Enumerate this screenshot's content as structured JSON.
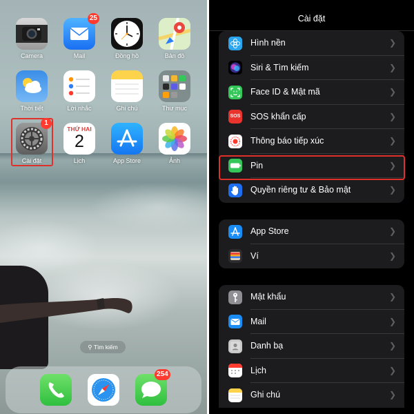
{
  "home_screen": {
    "apps": [
      {
        "label": "Camera",
        "icon": "camera-icon"
      },
      {
        "label": "Mail",
        "icon": "mail-icon",
        "badge": "25"
      },
      {
        "label": "Đồng hồ",
        "icon": "clock-icon"
      },
      {
        "label": "Bản đồ",
        "icon": "maps-icon"
      },
      {
        "label": "Thời tiết",
        "icon": "weather-icon"
      },
      {
        "label": "Lời nhắc",
        "icon": "reminders-icon"
      },
      {
        "label": "Ghi chú",
        "icon": "notes-icon"
      },
      {
        "label": "Thư mục",
        "icon": "folder-icon"
      },
      {
        "label": "Cài đặt",
        "icon": "settings-icon",
        "badge": "1"
      },
      {
        "label": "Lịch",
        "icon": "calendar-icon",
        "day_name": "THỨ HAI",
        "day_number": "2"
      },
      {
        "label": "App Store",
        "icon": "app-store-icon"
      },
      {
        "label": "Ảnh",
        "icon": "photos-icon"
      }
    ],
    "search_label": "Tìm kiếm",
    "dock": [
      {
        "icon": "phone-icon"
      },
      {
        "icon": "safari-icon"
      },
      {
        "icon": "messages-icon",
        "badge": "254"
      }
    ]
  },
  "settings": {
    "title": "Cài đặt",
    "groups": [
      [
        {
          "label": "Hình nền",
          "icon": "wallpaper-icon"
        },
        {
          "label": "Siri & Tìm kiếm",
          "icon": "siri-icon"
        },
        {
          "label": "Face ID & Mật mã",
          "icon": "face-id-icon"
        },
        {
          "label": "SOS khẩn cấp",
          "icon": "sos-icon",
          "icon_text": "SOS"
        },
        {
          "label": "Thông báo tiếp xúc",
          "icon": "exposure-notification-icon"
        },
        {
          "label": "Pin",
          "icon": "battery-icon"
        },
        {
          "label": "Quyền riêng tư & Bảo mật",
          "icon": "privacy-hand-icon"
        }
      ],
      [
        {
          "label": "App Store",
          "icon": "app-store-icon"
        },
        {
          "label": "Ví",
          "icon": "wallet-icon"
        }
      ],
      [
        {
          "label": "Mật khẩu",
          "icon": "key-icon"
        },
        {
          "label": "Mail",
          "icon": "mail-icon"
        },
        {
          "label": "Danh bạ",
          "icon": "contacts-icon"
        },
        {
          "label": "Lịch",
          "icon": "calendar-icon"
        },
        {
          "label": "Ghi chú",
          "icon": "notes-icon"
        }
      ]
    ],
    "highlighted_row": "Pin"
  },
  "colors": {
    "highlight": "#e0302a",
    "badge": "#ff3b30",
    "settings_bg": "#000000",
    "group_bg": "#1c1c1e"
  }
}
